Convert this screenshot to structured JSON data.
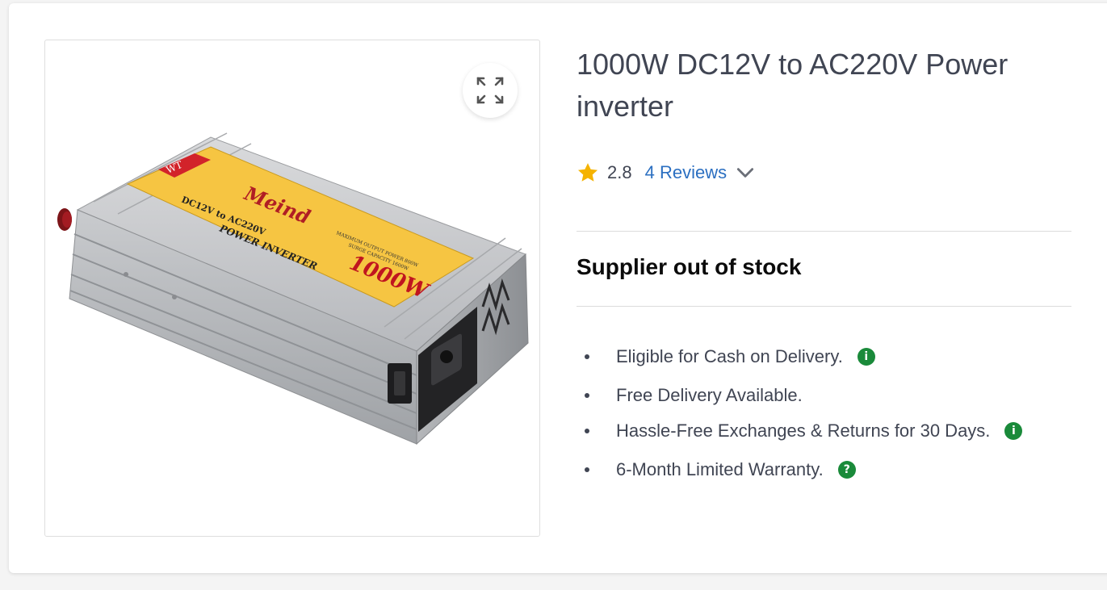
{
  "product": {
    "title": "1000W DC12V to AC220V Power inverter",
    "image_label": {
      "brand_tag": "WT",
      "brand": "Meind",
      "model_line": "DC12V to AC220V",
      "type_line": "POWER INVERTER",
      "spec_line_1": "MAXIMUM OUTPUT POWER 800W",
      "spec_line_2": "SURGE CAPACITY 1600W",
      "wattage": "1000W"
    },
    "expand_icon": "expand-icon"
  },
  "rating": {
    "value": "2.8",
    "reviews_label": "4 Reviews",
    "star_color": "#f5b301"
  },
  "stock": {
    "status": "Supplier out of stock"
  },
  "benefits": [
    {
      "text": "Eligible for Cash on Delivery.",
      "badge": "i"
    },
    {
      "text": "Free Delivery Available.",
      "badge": ""
    },
    {
      "text": "Hassle-Free Exchanges & Returns for 30 Days.",
      "badge": "i"
    },
    {
      "text": "6-Month Limited Warranty.",
      "badge": "?"
    }
  ],
  "colors": {
    "link": "#2b6fc1",
    "badge": "#1a8a3a",
    "text": "#404553"
  }
}
